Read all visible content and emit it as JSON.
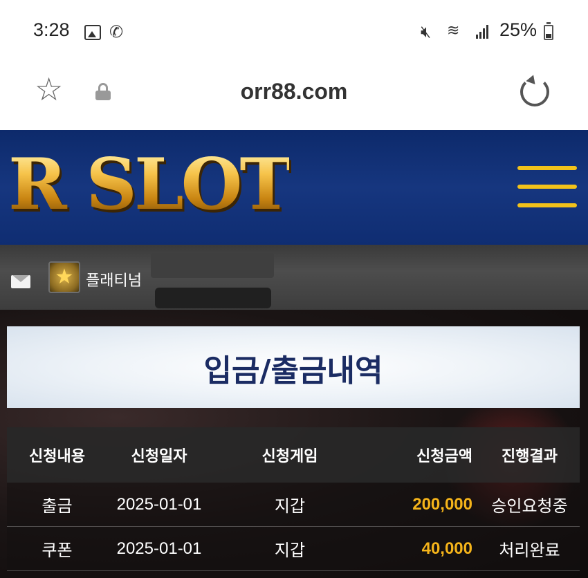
{
  "status_bar": {
    "time": "3:28",
    "battery": "25%",
    "icons": [
      "image-icon",
      "missed-call-icon",
      "mute-icon",
      "wifi-icon",
      "signal-icon",
      "battery-icon"
    ]
  },
  "browser": {
    "url": "orr88.com",
    "icons": [
      "star-icon",
      "lock-icon",
      "reload-icon"
    ]
  },
  "site": {
    "logo": "R SLOT",
    "menu_icon": "hamburger-icon",
    "accent_color": "#f2c21a",
    "header_color": "#16367f"
  },
  "user": {
    "rank": "플래티넘",
    "icons": [
      "mail-icon",
      "rank-badge-icon"
    ]
  },
  "page": {
    "title": "입금/출금내역"
  },
  "table": {
    "headers": [
      "신청내용",
      "신청일자",
      "신청게임",
      "신청금액",
      "진행결과"
    ],
    "rows": [
      [
        "출금",
        "2025-01-01",
        "지갑",
        "200,000",
        "승인요청중"
      ],
      [
        "쿠폰",
        "2025-01-01",
        "지갑",
        "40,000",
        "처리완료"
      ]
    ],
    "amount_color": "#f5b41a"
  }
}
